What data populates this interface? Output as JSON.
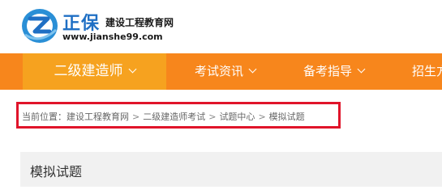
{
  "header": {
    "brand": "正保",
    "brand_sub": "建设工程教育网",
    "url": "www.jianshe99.com"
  },
  "nav": {
    "items": [
      {
        "label": "二级建造师"
      },
      {
        "label": "考试资讯"
      },
      {
        "label": "备考指导"
      },
      {
        "label": "招生方"
      }
    ]
  },
  "breadcrumb": {
    "prefix": "当前位置：",
    "items": [
      "建设工程教育网",
      "二级建造师考试",
      "试题中心",
      "模拟试题"
    ],
    "separator": ">"
  },
  "section": {
    "title": "模拟试题"
  },
  "colors": {
    "nav_bg": "#f7861c",
    "nav_active_bg": "#f6a21f",
    "highlight_border": "#e0142a",
    "brand_blue": "#1f6fc4"
  }
}
